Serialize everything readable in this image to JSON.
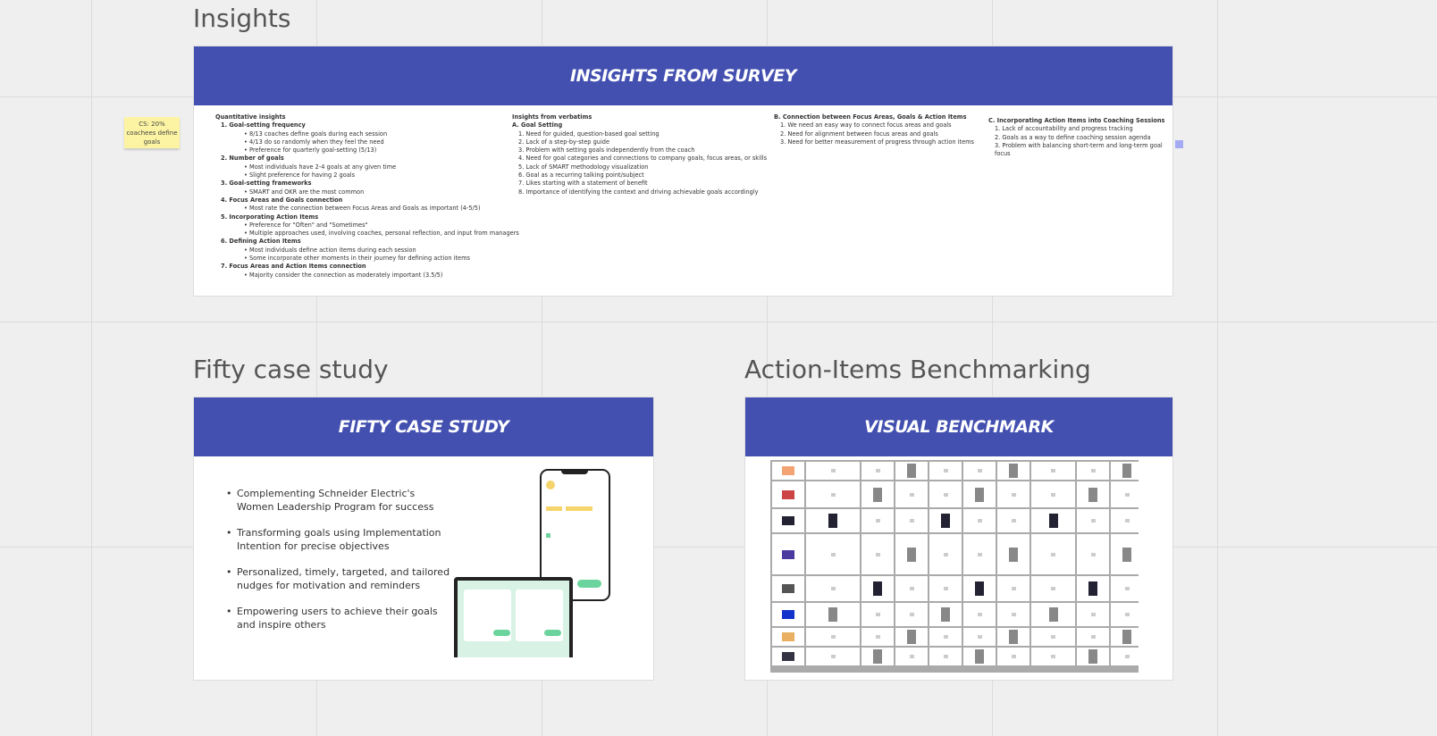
{
  "sections": {
    "insights_title": "Insights",
    "fifty_title": "Fifty case study",
    "benchmark_title": "Action-Items Benchmarking"
  },
  "insights_board": {
    "header": "Insights from survey",
    "quantitative": {
      "title": "Quantitative insights",
      "groups": [
        {
          "n": "1.",
          "title": "Goal-setting frequency",
          "items": [
            "8/13 coaches define goals during each session",
            "4/13 do so randomly when they feel the need",
            "Preference for quarterly goal-setting (5/13)"
          ]
        },
        {
          "n": "2.",
          "title": "Number of goals",
          "items": [
            "Most individuals have 2-4 goals at any given time",
            "Slight preference for having 2 goals"
          ]
        },
        {
          "n": "3.",
          "title": "Goal-setting frameworks",
          "items": [
            "SMART and OKR are the most common"
          ]
        },
        {
          "n": "4.",
          "title": "Focus Areas and Goals connection",
          "items": [
            "Most rate the connection between Focus Areas and Goals as important (4-5/5)"
          ]
        },
        {
          "n": "5.",
          "title": "Incorporating Action Items",
          "items": [
            "Preference for \"Often\" and \"Sometimes\"",
            "Multiple approaches used, involving coaches, personal reflection, and input from managers"
          ]
        },
        {
          "n": "6.",
          "title": "Defining Action Items",
          "items": [
            "Most individuals define action items during each session",
            "Some incorporate other moments in their journey for defining action items"
          ]
        },
        {
          "n": "7.",
          "title": "Focus Areas and Action Items connection",
          "items": [
            "Majority consider the connection as moderately important (3.5/5)"
          ]
        }
      ]
    },
    "verbatims": {
      "title": "Insights from verbatims",
      "sections": [
        {
          "letter": "A.",
          "title": "Goal Setting",
          "items": [
            "1. Need for guided, question-based goal setting",
            "2. Lack of a step-by-step guide",
            "3. Problem with setting goals independently from the coach",
            "4. Need for goal categories and connections to company goals, focus areas, or skills",
            "5. Lack of SMART methodology visualization",
            "6. Goal as a recurring talking point/subject",
            "7. Likes starting with a statement of benefit",
            "8. Importance of identifying the context and driving achievable goals accordingly"
          ]
        },
        {
          "letter": "B.",
          "title": "Connection between Focus Areas, Goals & Action Items",
          "items": [
            "1. We need an easy way to connect focus areas and goals",
            "2. Need for alignment between focus areas and goals",
            "3. Need for better measurement of progress through action items"
          ]
        },
        {
          "letter": "C.",
          "title": "Incorporating Action Items into Coaching Sessions",
          "items": [
            "1. Lack of accountability and progress tracking",
            "2. Goals as a way to define coaching session agenda",
            "3. Problem with balancing short-term and long-term goal focus"
          ]
        }
      ]
    }
  },
  "sticky_note": "CS: 20% coachees define goals",
  "fifty_board": {
    "header": "Fifty case study",
    "bullets": [
      "Complementing Schneider Electric's Women Leadership Program for success",
      "Transforming goals using Implementation Intention for precise objectives",
      "Personalized, timely, targeted, and tailored nudges for motivation and reminders",
      "Empowering users to achieve their goals and inspire others"
    ]
  },
  "benchmark_board": {
    "header": "Visual benchmark"
  },
  "colors": {
    "header": "#4350b0",
    "sticky": "#fdf4a3",
    "background": "#efefef"
  }
}
